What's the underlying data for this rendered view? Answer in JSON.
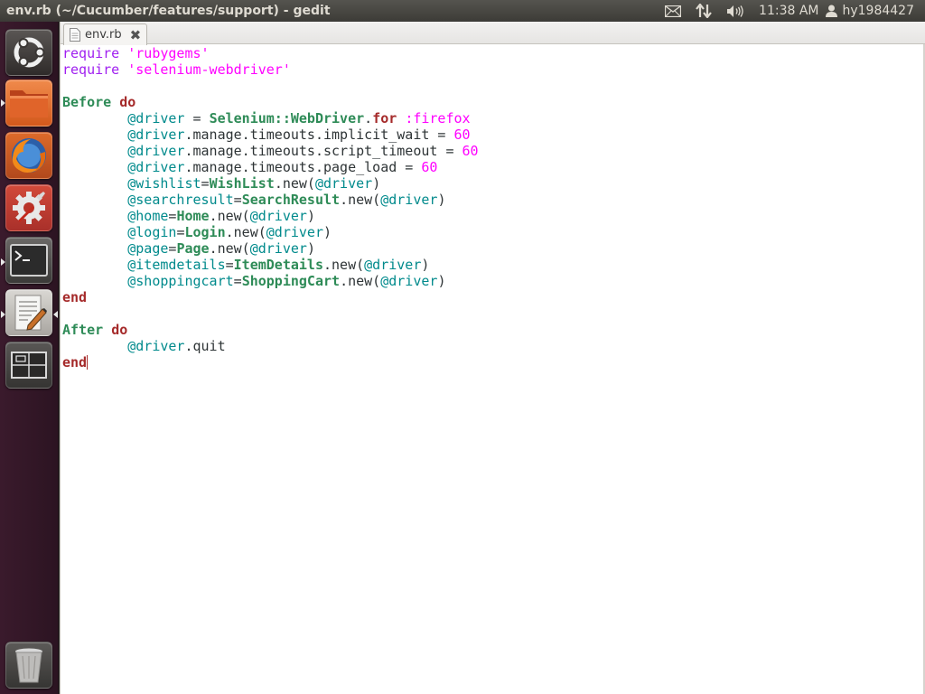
{
  "window": {
    "title": "env.rb (~/Cucumber/features/support) - gedit"
  },
  "panel": {
    "clock": "11:38 AM",
    "username": "hy1984427",
    "icons": [
      "mail-icon",
      "network-icon",
      "volume-icon",
      "user-icon"
    ]
  },
  "launcher": {
    "items": [
      "dash-home",
      "files",
      "firefox",
      "system-settings",
      "terminal",
      "text-editor",
      "workspace-switcher",
      "trash"
    ]
  },
  "editor": {
    "tab_label": "env.rb",
    "lines": [
      [
        [
          "req",
          "require"
        ],
        [
          "plain",
          " "
        ],
        [
          "str",
          "'rubygems'"
        ]
      ],
      [
        [
          "req",
          "require"
        ],
        [
          "plain",
          " "
        ],
        [
          "str",
          "'selenium-webdriver'"
        ]
      ],
      [],
      [
        [
          "const",
          "Before"
        ],
        [
          "plain",
          " "
        ],
        [
          "kw",
          "do"
        ]
      ],
      [
        [
          "plain",
          "        "
        ],
        [
          "ivar",
          "@driver"
        ],
        [
          "plain",
          " = "
        ],
        [
          "const",
          "Selenium::WebDriver"
        ],
        [
          "plain",
          "."
        ],
        [
          "kw",
          "for"
        ],
        [
          "plain",
          " "
        ],
        [
          "sym",
          ":firefox"
        ]
      ],
      [
        [
          "plain",
          "        "
        ],
        [
          "ivar",
          "@driver"
        ],
        [
          "plain",
          ".manage.timeouts.implicit_wait = "
        ],
        [
          "num",
          "60"
        ]
      ],
      [
        [
          "plain",
          "        "
        ],
        [
          "ivar",
          "@driver"
        ],
        [
          "plain",
          ".manage.timeouts.script_timeout = "
        ],
        [
          "num",
          "60"
        ]
      ],
      [
        [
          "plain",
          "        "
        ],
        [
          "ivar",
          "@driver"
        ],
        [
          "plain",
          ".manage.timeouts.page_load = "
        ],
        [
          "num",
          "60"
        ]
      ],
      [
        [
          "plain",
          "        "
        ],
        [
          "ivar",
          "@wishlist"
        ],
        [
          "plain",
          "="
        ],
        [
          "const",
          "WishList"
        ],
        [
          "plain",
          ".new("
        ],
        [
          "ivar",
          "@driver"
        ],
        [
          "plain",
          ")"
        ]
      ],
      [
        [
          "plain",
          "        "
        ],
        [
          "ivar",
          "@searchresult"
        ],
        [
          "plain",
          "="
        ],
        [
          "const",
          "SearchResult"
        ],
        [
          "plain",
          ".new("
        ],
        [
          "ivar",
          "@driver"
        ],
        [
          "plain",
          ")"
        ]
      ],
      [
        [
          "plain",
          "        "
        ],
        [
          "ivar",
          "@home"
        ],
        [
          "plain",
          "="
        ],
        [
          "const",
          "Home"
        ],
        [
          "plain",
          ".new("
        ],
        [
          "ivar",
          "@driver"
        ],
        [
          "plain",
          ")"
        ]
      ],
      [
        [
          "plain",
          "        "
        ],
        [
          "ivar",
          "@login"
        ],
        [
          "plain",
          "="
        ],
        [
          "const",
          "Login"
        ],
        [
          "plain",
          ".new("
        ],
        [
          "ivar",
          "@driver"
        ],
        [
          "plain",
          ")"
        ]
      ],
      [
        [
          "plain",
          "        "
        ],
        [
          "ivar",
          "@page"
        ],
        [
          "plain",
          "="
        ],
        [
          "const",
          "Page"
        ],
        [
          "plain",
          ".new("
        ],
        [
          "ivar",
          "@driver"
        ],
        [
          "plain",
          ")"
        ]
      ],
      [
        [
          "plain",
          "        "
        ],
        [
          "ivar",
          "@itemdetails"
        ],
        [
          "plain",
          "="
        ],
        [
          "const",
          "ItemDetails"
        ],
        [
          "plain",
          ".new("
        ],
        [
          "ivar",
          "@driver"
        ],
        [
          "plain",
          ")"
        ]
      ],
      [
        [
          "plain",
          "        "
        ],
        [
          "ivar",
          "@shoppingcart"
        ],
        [
          "plain",
          "="
        ],
        [
          "const",
          "ShoppingCart"
        ],
        [
          "plain",
          ".new("
        ],
        [
          "ivar",
          "@driver"
        ],
        [
          "plain",
          ")"
        ]
      ],
      [
        [
          "kw",
          "end"
        ]
      ],
      [],
      [
        [
          "const",
          "After"
        ],
        [
          "plain",
          " "
        ],
        [
          "kw",
          "do"
        ]
      ],
      [
        [
          "plain",
          "        "
        ],
        [
          "ivar",
          "@driver"
        ],
        [
          "plain",
          ".quit"
        ]
      ],
      [
        [
          "kw",
          "end"
        ]
      ]
    ]
  }
}
